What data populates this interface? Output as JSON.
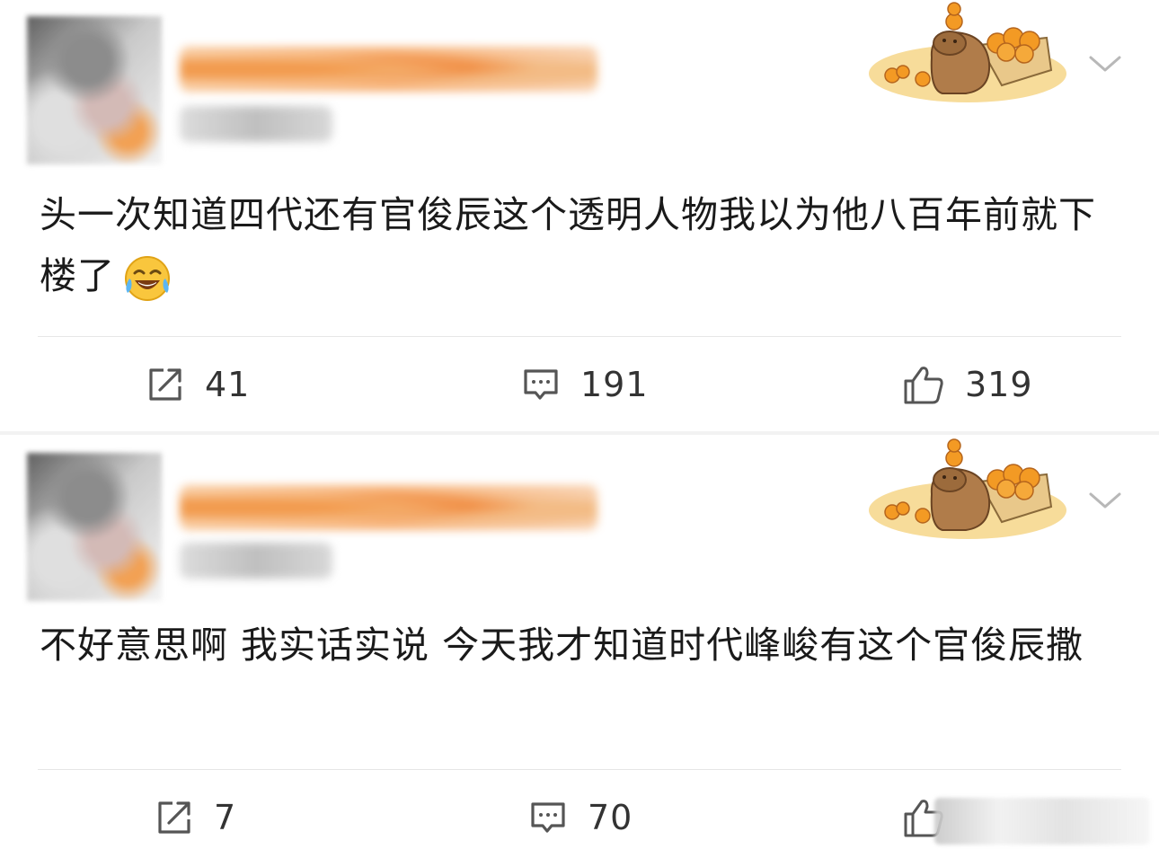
{
  "posts": [
    {
      "text": "头一次知道四代还有官俊辰这个透明人物我以为他八百年前就下楼了",
      "emoji": "laughing-tears-emoji",
      "repost_count": "41",
      "comment_count": "191",
      "like_count": "319"
    },
    {
      "text": "不好意思啊 我实话实说 今天我才知道时代峰峻有这个官俊辰撒",
      "repost_count": "7",
      "comment_count": "70",
      "like_count": ""
    }
  ],
  "icons": {
    "repost": "repost-icon",
    "comment": "comment-icon",
    "like": "thumbs-up-icon",
    "more": "chevron-down-icon",
    "sticker": "capybara-oranges-sticker"
  },
  "colors": {
    "text": "#1a1a1a",
    "count": "#333333",
    "divider": "#e6e6e6",
    "sticker_bg": "#f7dc9a",
    "orange": "#f39a24"
  }
}
